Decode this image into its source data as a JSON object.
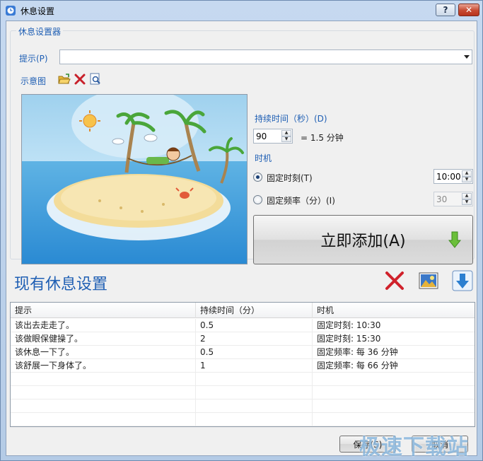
{
  "window": {
    "title": "休息设置",
    "help_label": "?",
    "close_label": "✕"
  },
  "settings": {
    "group_label": "休息设置器",
    "prompt_label": "提示(P)",
    "prompt_value": "",
    "preview_label": "示意图",
    "duration_label": "持续时间（秒）(D)",
    "duration_value": "90",
    "duration_equiv": "= 1.5 分钟",
    "timing_label": "时机",
    "fixed_time_label": "固定时刻(T)",
    "fixed_time_value": "10:00",
    "fixed_freq_label": "固定频率（分）(I)",
    "fixed_freq_value": "30",
    "add_now_label": "立即添加(A)"
  },
  "existing": {
    "title": "现有休息设置",
    "columns": [
      "提示",
      "持续时间（分）",
      "时机"
    ],
    "rows": [
      {
        "prompt": "该出去走走了。",
        "duration": "0.5",
        "timing": "固定时刻: 10:30"
      },
      {
        "prompt": "该做眼保健操了。",
        "duration": "2",
        "timing": "固定时刻: 15:30"
      },
      {
        "prompt": "该休息一下了。",
        "duration": "0.5",
        "timing": "固定频率: 每 36 分钟"
      },
      {
        "prompt": "该舒展一下身体了。",
        "duration": "1",
        "timing": "固定频率: 每 66 分钟"
      }
    ]
  },
  "footer": {
    "save_label": "保存(S)",
    "cancel_label": "取消"
  },
  "watermark": "极速下载站",
  "colors": {
    "accent": "#1f5fb4",
    "close": "#c74a32",
    "arrow": "#6bbf3a"
  }
}
